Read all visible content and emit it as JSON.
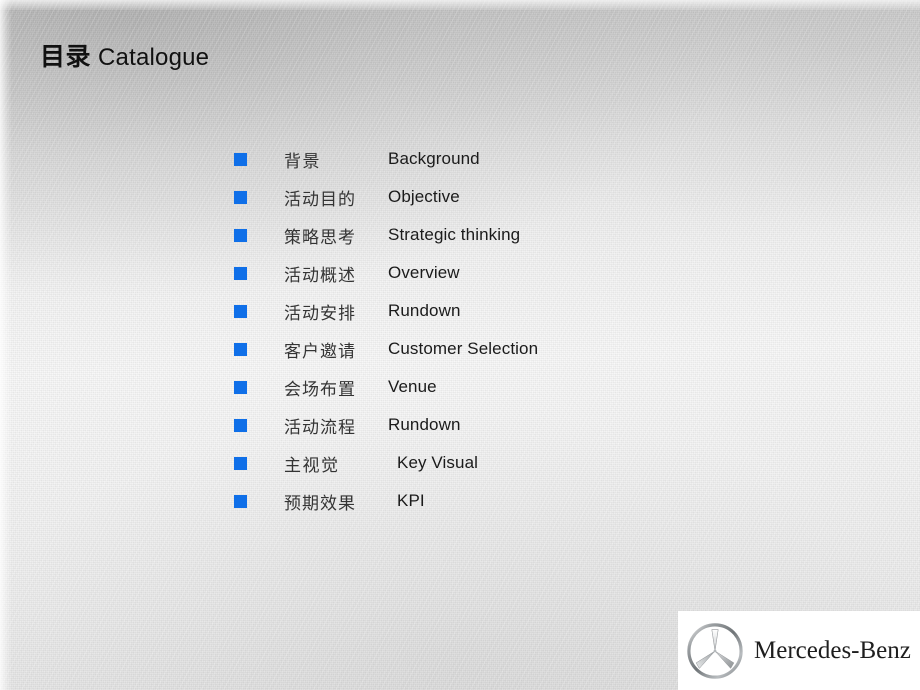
{
  "slide": {
    "title_cn": "目录",
    "title_en": "Catalogue",
    "background_color": "#e9e9e9",
    "accent_color": "#0f6fe8"
  },
  "catalogue": {
    "items": [
      {
        "bullet": "square-bullet",
        "cn": "背景",
        "en": "Background",
        "indent": false
      },
      {
        "bullet": "square-bullet",
        "cn": "活动目的",
        "en": "Objective",
        "indent": false
      },
      {
        "bullet": "square-bullet",
        "cn": "策略思考",
        "en": "Strategic thinking",
        "indent": false
      },
      {
        "bullet": "square-bullet",
        "cn": "活动概述",
        "en": "Overview",
        "indent": false
      },
      {
        "bullet": "square-bullet",
        "cn": "活动安排",
        "en": "Rundown",
        "indent": false
      },
      {
        "bullet": "square-bullet",
        "cn": "客户邀请",
        "en": "Customer Selection",
        "indent": false
      },
      {
        "bullet": "square-bullet",
        "cn": "会场布置",
        "en": "Venue",
        "indent": false
      },
      {
        "bullet": "square-bullet",
        "cn": "活动流程",
        "en": "Rundown",
        "indent": false
      },
      {
        "bullet": "square-bullet",
        "cn": "主视觉",
        "en": "Key Visual",
        "indent": true
      },
      {
        "bullet": "square-bullet",
        "cn": "预期效果",
        "en": "KPI",
        "indent": true
      }
    ]
  },
  "logo": {
    "wordmark": "Mercedes-Benz",
    "star_icon": "mercedes-star-icon",
    "plate_color": "#ffffff"
  }
}
